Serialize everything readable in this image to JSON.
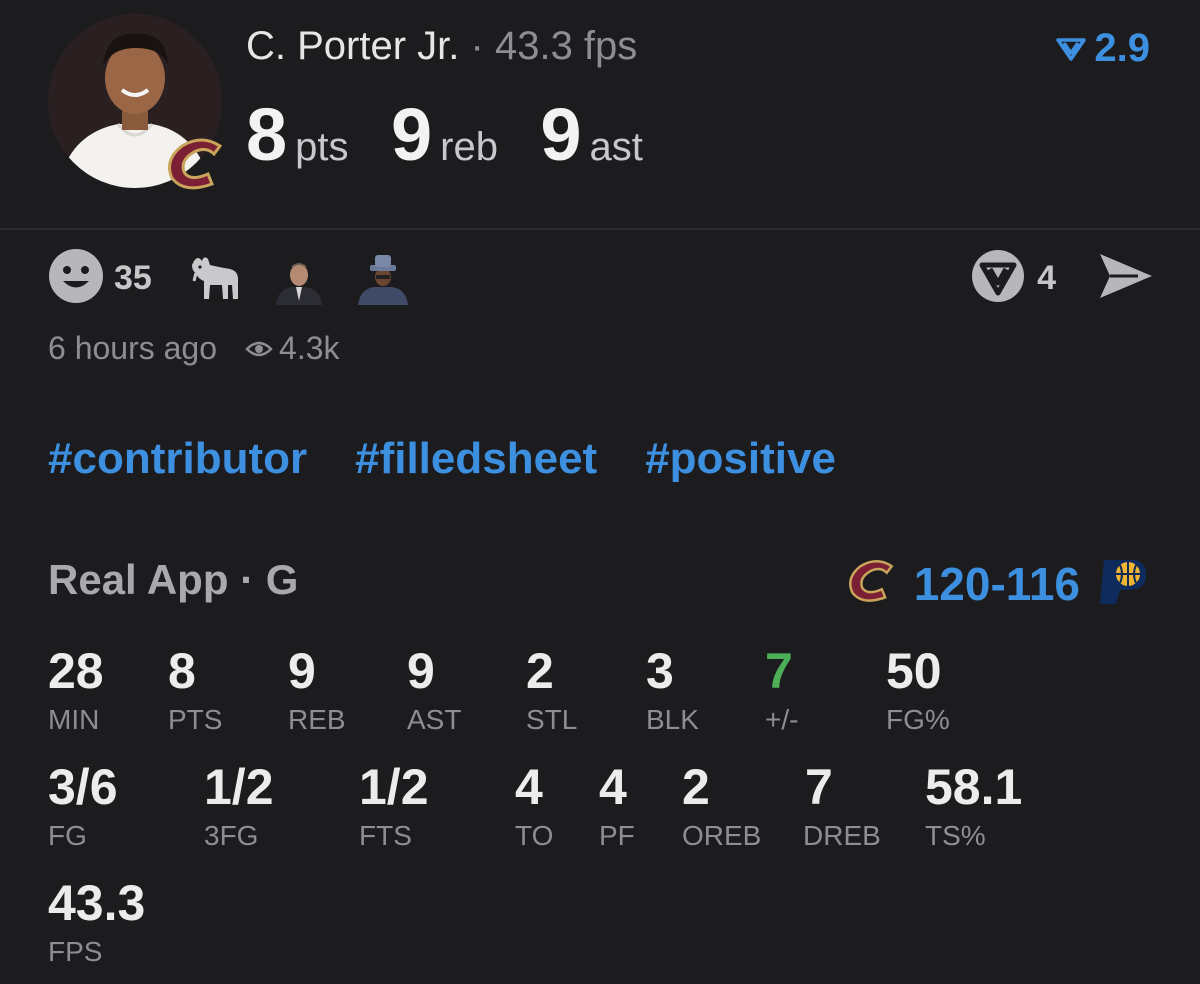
{
  "player": {
    "name": "C. Porter Jr.",
    "separator": "·",
    "fps": "43.3 fps",
    "pts": "8",
    "pts_unit": "pts",
    "reb": "9",
    "reb_unit": "reb",
    "ast": "9",
    "ast_unit": "ast",
    "vote_score": "2.9"
  },
  "reactions": {
    "smiley_count": "35",
    "comment_count": "4",
    "icons": [
      "smiley-icon",
      "goat-icon",
      "commissioner-icon",
      "hat-man-icon",
      "comment-icon",
      "share-icon"
    ]
  },
  "meta": {
    "time_ago": "6 hours ago",
    "views": "4.3k"
  },
  "tags": [
    "#contributor",
    "#filledsheet",
    "#positive"
  ],
  "game": {
    "title": "Real App · G",
    "score": "120-116",
    "colors": {
      "accent": "#3d8fe0",
      "positive": "#4caf58",
      "cavs_wine": "#7a1f34",
      "cavs_gold": "#c9a45a",
      "pacers_navy": "#0e2b5c",
      "pacers_gold": "#f2b531"
    }
  },
  "stats_row1": [
    {
      "value": "28",
      "label": "MIN"
    },
    {
      "value": "8",
      "label": "PTS"
    },
    {
      "value": "9",
      "label": "REB"
    },
    {
      "value": "9",
      "label": "AST"
    },
    {
      "value": "2",
      "label": "STL"
    },
    {
      "value": "3",
      "label": "BLK"
    },
    {
      "value": "7",
      "label": "+/-"
    },
    {
      "value": "50",
      "label": "FG%"
    }
  ],
  "stats_row2": [
    {
      "value": "3/6",
      "label": "FG"
    },
    {
      "value": "1/2",
      "label": "3FG"
    },
    {
      "value": "1/2",
      "label": "FTS"
    },
    {
      "value": "4",
      "label": "TO"
    },
    {
      "value": "4",
      "label": "PF"
    },
    {
      "value": "2",
      "label": "OREB"
    },
    {
      "value": "7",
      "label": "DREB"
    },
    {
      "value": "58.1",
      "label": "TS%"
    }
  ],
  "stats_row3": [
    {
      "value": "43.3",
      "label": "FPS"
    }
  ]
}
